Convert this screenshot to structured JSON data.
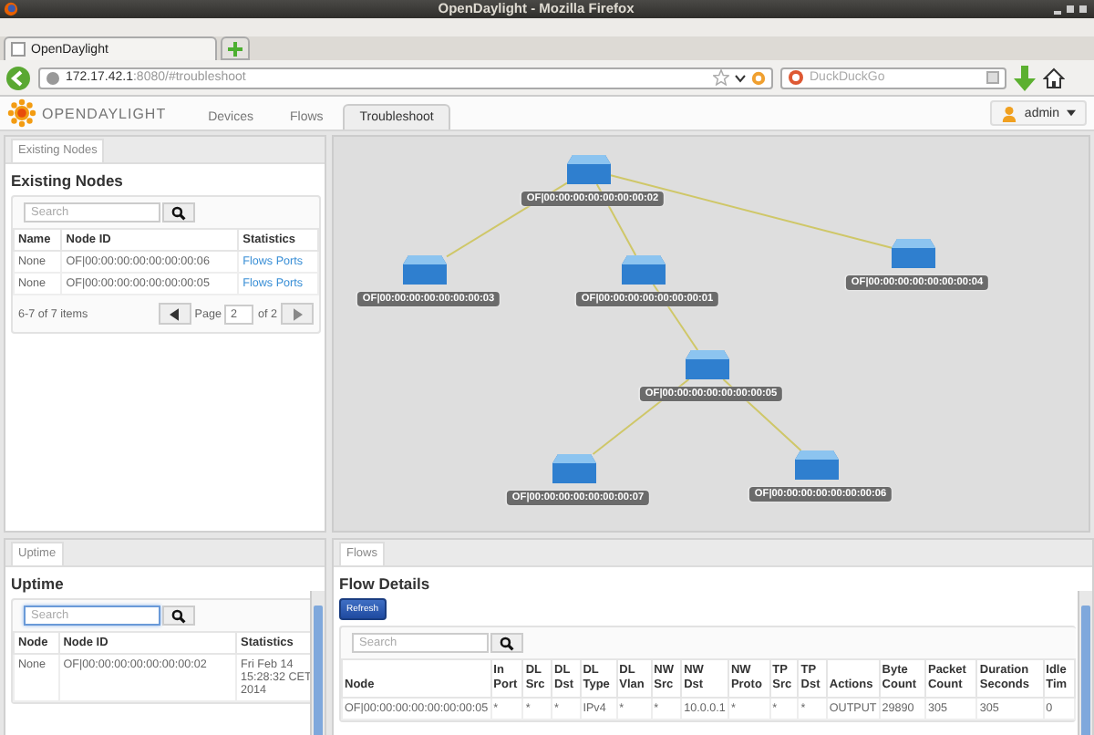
{
  "window": {
    "title": "OpenDaylight - Mozilla Firefox"
  },
  "browser_tabs": [
    {
      "label": "OpenDaylight",
      "selected": true
    }
  ],
  "address_bar": {
    "host": "172.17.42.1",
    "rest": ":8080/#troubleshoot"
  },
  "search_bar": {
    "placeholder": "DuckDuckGo"
  },
  "app": {
    "logo": "OPENDAYLIGHT",
    "nav_tabs": [
      {
        "label": "Devices",
        "selected": false
      },
      {
        "label": "Flows",
        "selected": false
      },
      {
        "label": "Troubleshoot",
        "selected": true
      }
    ],
    "user": "admin"
  },
  "existing_nodes": {
    "tab": "Existing Nodes",
    "title": "Existing Nodes",
    "search": {
      "placeholder": "Search"
    },
    "columns": [
      "Name",
      "Node ID",
      "Statistics"
    ],
    "rows": [
      {
        "name": "None",
        "node_id": "OF|00:00:00:00:00:00:00:06",
        "links": [
          "Flows",
          "Ports"
        ]
      },
      {
        "name": "None",
        "node_id": "OF|00:00:00:00:00:00:00:05",
        "links": [
          "Flows",
          "Ports"
        ]
      }
    ],
    "items": "6-7 of 7 items",
    "page_label": "Page",
    "page": "2",
    "of": "of 2"
  },
  "topology": {
    "nodes": [
      {
        "label": "OF|00:00:00:00:00:00:00:02",
        "children": [
          {
            "label": "OF|00:00:00:00:00:00:00:03"
          },
          {
            "label": "OF|00:00:00:00:00:00:00:01",
            "children": [
              {
                "label": "OF|00:00:00:00:00:00:00:05",
                "children": [
                  {
                    "label": "OF|00:00:00:00:00:00:00:07"
                  },
                  {
                    "label": "OF|00:00:00:00:00:00:00:06"
                  }
                ]
              }
            ]
          },
          {
            "label": "OF|00:00:00:00:00:00:00:04"
          }
        ]
      }
    ]
  },
  "uptime": {
    "tab": "Uptime",
    "title": "Uptime",
    "search": {
      "placeholder": "Search"
    },
    "columns": [
      "Node",
      "Node ID",
      "Statistics"
    ],
    "rows": [
      [
        "None",
        "OF|00:00:00:00:00:00:00:02",
        "Fri Feb 14 15:28:32 CET 2014"
      ]
    ]
  },
  "flows": {
    "tab": "Flows",
    "title": "Flow Details",
    "refresh": "Refresh",
    "search": {
      "placeholder": "Search"
    },
    "columns": [
      "Node",
      "In Port",
      "DL Src",
      "DL Dst",
      "DL Type",
      "DL Vlan",
      "NW Src",
      "NW Dst",
      "NW Proto",
      "TP Src",
      "TP Dst",
      "Actions",
      "Byte Count",
      "Packet Count",
      "Duration Seconds",
      "Idle Tim"
    ],
    "rows": [
      [
        "OF|00:00:00:00:00:00:00:05",
        "*",
        "*",
        "*",
        "IPv4",
        "*",
        "*",
        "10.0.0.1",
        "*",
        "*",
        "*",
        "OUTPUT",
        "29890",
        "305",
        "305",
        "0"
      ]
    ]
  }
}
